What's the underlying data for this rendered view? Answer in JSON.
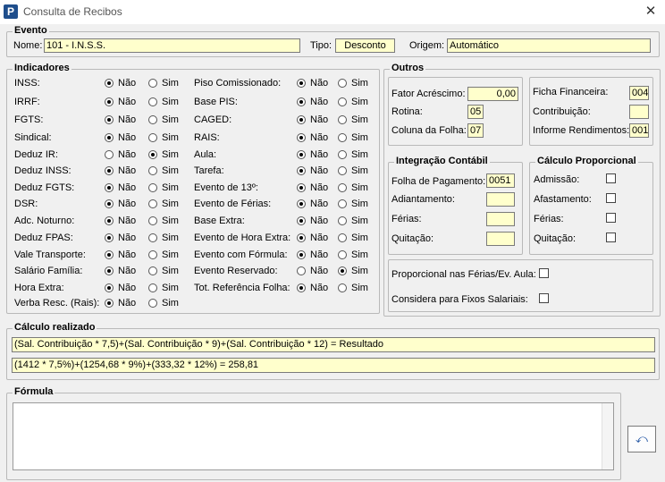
{
  "window": {
    "title": "Consulta de Recibos",
    "app_icon": "P",
    "close_glyph": "✕"
  },
  "evento": {
    "group_title": "Evento",
    "nome_label": "Nome:",
    "nome_value": "101 - I.N.S.S.",
    "tipo_label": "Tipo:",
    "tipo_value": "Desconto",
    "origem_label": "Origem:",
    "origem_value": "Automático"
  },
  "indicadores": {
    "group_title": "Indicadores",
    "nao_label": "Não",
    "sim_label": "Sim",
    "left": [
      {
        "label": "INSS:",
        "value": "Não"
      },
      {
        "label": "IRRF:",
        "value": "Não"
      },
      {
        "label": "FGTS:",
        "value": "Não"
      },
      {
        "label": "Sindical:",
        "value": "Não"
      },
      {
        "label": "Deduz IR:",
        "value": "Sim"
      },
      {
        "label": "Deduz INSS:",
        "value": "Não"
      },
      {
        "label": "Deduz FGTS:",
        "value": "Não"
      },
      {
        "label": "DSR:",
        "value": "Não"
      },
      {
        "label": "Adc. Noturno:",
        "value": "Não"
      },
      {
        "label": "Deduz FPAS:",
        "value": "Não"
      },
      {
        "label": "Vale Transporte:",
        "value": "Não"
      },
      {
        "label": "Salário Família:",
        "value": "Não"
      },
      {
        "label": "Hora Extra:",
        "value": "Não"
      },
      {
        "label": "Verba Resc. (Rais):",
        "value": "Não"
      }
    ],
    "right": [
      {
        "label": "Piso Comissionado:",
        "value": "Não"
      },
      {
        "label": "Base PIS:",
        "value": "Não"
      },
      {
        "label": "CAGED:",
        "value": "Não"
      },
      {
        "label": "RAIS:",
        "value": "Não"
      },
      {
        "label": "Aula:",
        "value": "Não"
      },
      {
        "label": "Tarefa:",
        "value": "Não"
      },
      {
        "label": "Evento de 13º:",
        "value": "Não"
      },
      {
        "label": "Evento de Férias:",
        "value": "Não"
      },
      {
        "label": "Base Extra:",
        "value": "Não"
      },
      {
        "label": "Evento de Hora Extra:",
        "value": "Não"
      },
      {
        "label": "Evento com Fórmula:",
        "value": "Não"
      },
      {
        "label": "Evento Reservado:",
        "value": "Sim"
      },
      {
        "label": "Tot. Referência Folha:",
        "value": "Não"
      }
    ]
  },
  "outros": {
    "group_title": "Outros",
    "fator_label": "Fator Acréscimo:",
    "fator_value": "0,00",
    "rotina_label": "Rotina:",
    "rotina_value": "05",
    "coluna_label": "Coluna da Folha:",
    "coluna_value": "07",
    "ficha_label": "Ficha Financeira:",
    "ficha_value": "004",
    "contrib_label": "Contribuição:",
    "contrib_value": "",
    "informe_label": "Informe Rendimentos:",
    "informe_value": "001"
  },
  "integracao": {
    "group_title": "Integração Contábil",
    "folha_label": "Folha de Pagamento:",
    "folha_value": "0051",
    "adiant_label": "Adiantamento:",
    "adiant_value": "",
    "ferias_label": "Férias:",
    "ferias_value": "",
    "quitacao_label": "Quitação:",
    "quitacao_value": ""
  },
  "proporcional": {
    "group_title": "Cálculo Proporcional",
    "admissao_label": "Admissão:",
    "afastamento_label": "Afastamento:",
    "ferias_label": "Férias:",
    "quitacao_label": "Quitação:"
  },
  "opcoes": {
    "prop_ferias_label": "Proporcional nas Férias/Ev. Aula:",
    "fixos_label": "Considera para Fixos Salariais:"
  },
  "calculo": {
    "group_title": "Cálculo realizado",
    "line1": "(Sal. Contribuição * 7,5)+(Sal. Contribuição * 9)+(Sal. Contribuição * 12) = Resultado",
    "line2": "(1412 * 7,5%)+(1254,68 * 9%)+(333,32 * 12%) = 258,81"
  },
  "formula": {
    "group_title": "Fórmula",
    "value": "",
    "button_glyph": "⤺"
  }
}
